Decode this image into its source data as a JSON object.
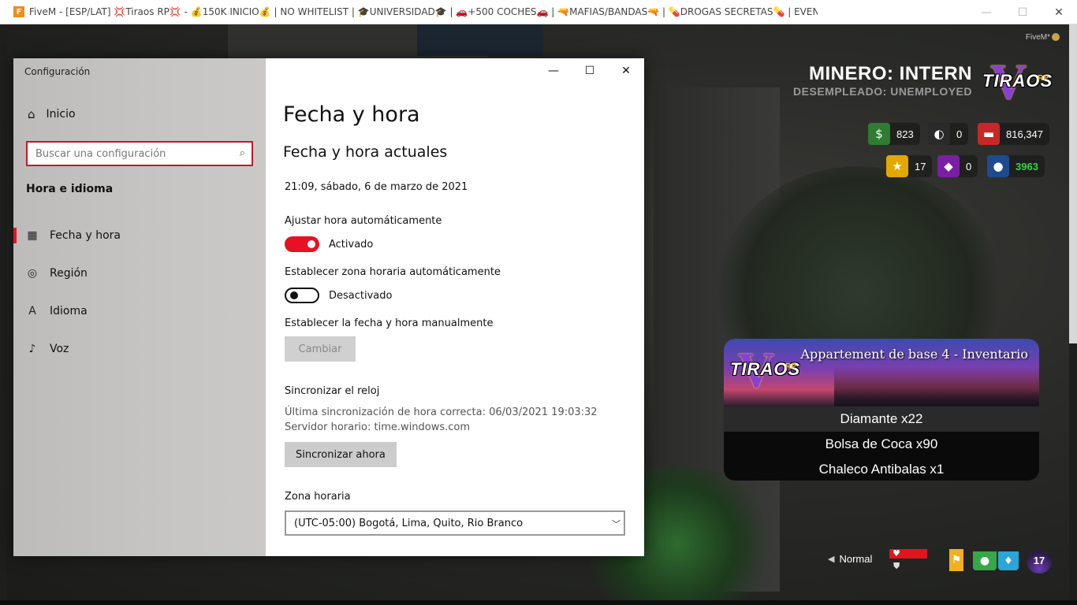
{
  "game_window": {
    "title": "FiveM - [ESP/LAT] 💢Tiraos RP💢 - 💰150K INICIO💰 | NO WHITELIST | 🎓UNIVERSIDAD🎓 | 🚗+500 COCHES🚗 | 🔫MAFIAS/BANDAS🔫 | 💊DROGAS SECRETAS💊 | EVENTOS | discord.gg/tiraosrp",
    "app_icon": "fivem-icon"
  },
  "hud": {
    "fivem_tag": "FiveM*",
    "job_title": "MINERO: INTERN",
    "job_sub": "DESEMPLEADO: UNEMPLOYED",
    "logo_text": "TIRAOS",
    "logo_rp": "RP",
    "logo_v": "V",
    "stats": {
      "cash": "823",
      "mask": "0",
      "bank": "816,347",
      "stars": "17",
      "gems": "0",
      "user_id": "3963"
    },
    "stat_colors": {
      "cash": "#2e7d32",
      "mask": "#2a2a2a",
      "bank": "#c62828",
      "stars": "#e0a800",
      "gems": "#7b1fa2",
      "user": "#1e4b8f",
      "user_id_text": "#3cd24a"
    },
    "voice": "Normal",
    "level": "17"
  },
  "inventory": {
    "title": "Appartement de base 4 - Inventario",
    "items": [
      "Diamante x22",
      "Bolsa de Coca x90",
      "Chaleco Antibalas x1"
    ]
  },
  "settings": {
    "app_title": "Configuración",
    "home_label": "Inicio",
    "search_placeholder": "Buscar una configuración",
    "section": "Hora e idioma",
    "nav": [
      {
        "label": "Fecha y hora",
        "icon": "calendar-clock-icon"
      },
      {
        "label": "Región",
        "icon": "globe-icon"
      },
      {
        "label": "Idioma",
        "icon": "language-icon"
      },
      {
        "label": "Voz",
        "icon": "microphone-icon"
      }
    ],
    "page_title": "Fecha y hora",
    "current_heading": "Fecha y hora actuales",
    "current_datetime": "21:09, sábado, 6 de marzo de 2021",
    "auto_time_label": "Ajustar hora automáticamente",
    "auto_time_state": "Activado",
    "auto_tz_label": "Establecer zona horaria automáticamente",
    "auto_tz_state": "Desactivado",
    "manual_label": "Establecer la fecha y hora manualmente",
    "change_button": "Cambiar",
    "sync_heading": "Sincronizar el reloj",
    "last_sync": "Última sincronización de hora correcta: 06/03/2021 19:03:32",
    "time_server": "Servidor horario: time.windows.com",
    "sync_button": "Sincronizar ahora",
    "tz_label": "Zona horaria",
    "tz_value": "(UTC-05:00) Bogotá, Lima, Quito, Rio Branco",
    "accent": "#e81123"
  }
}
